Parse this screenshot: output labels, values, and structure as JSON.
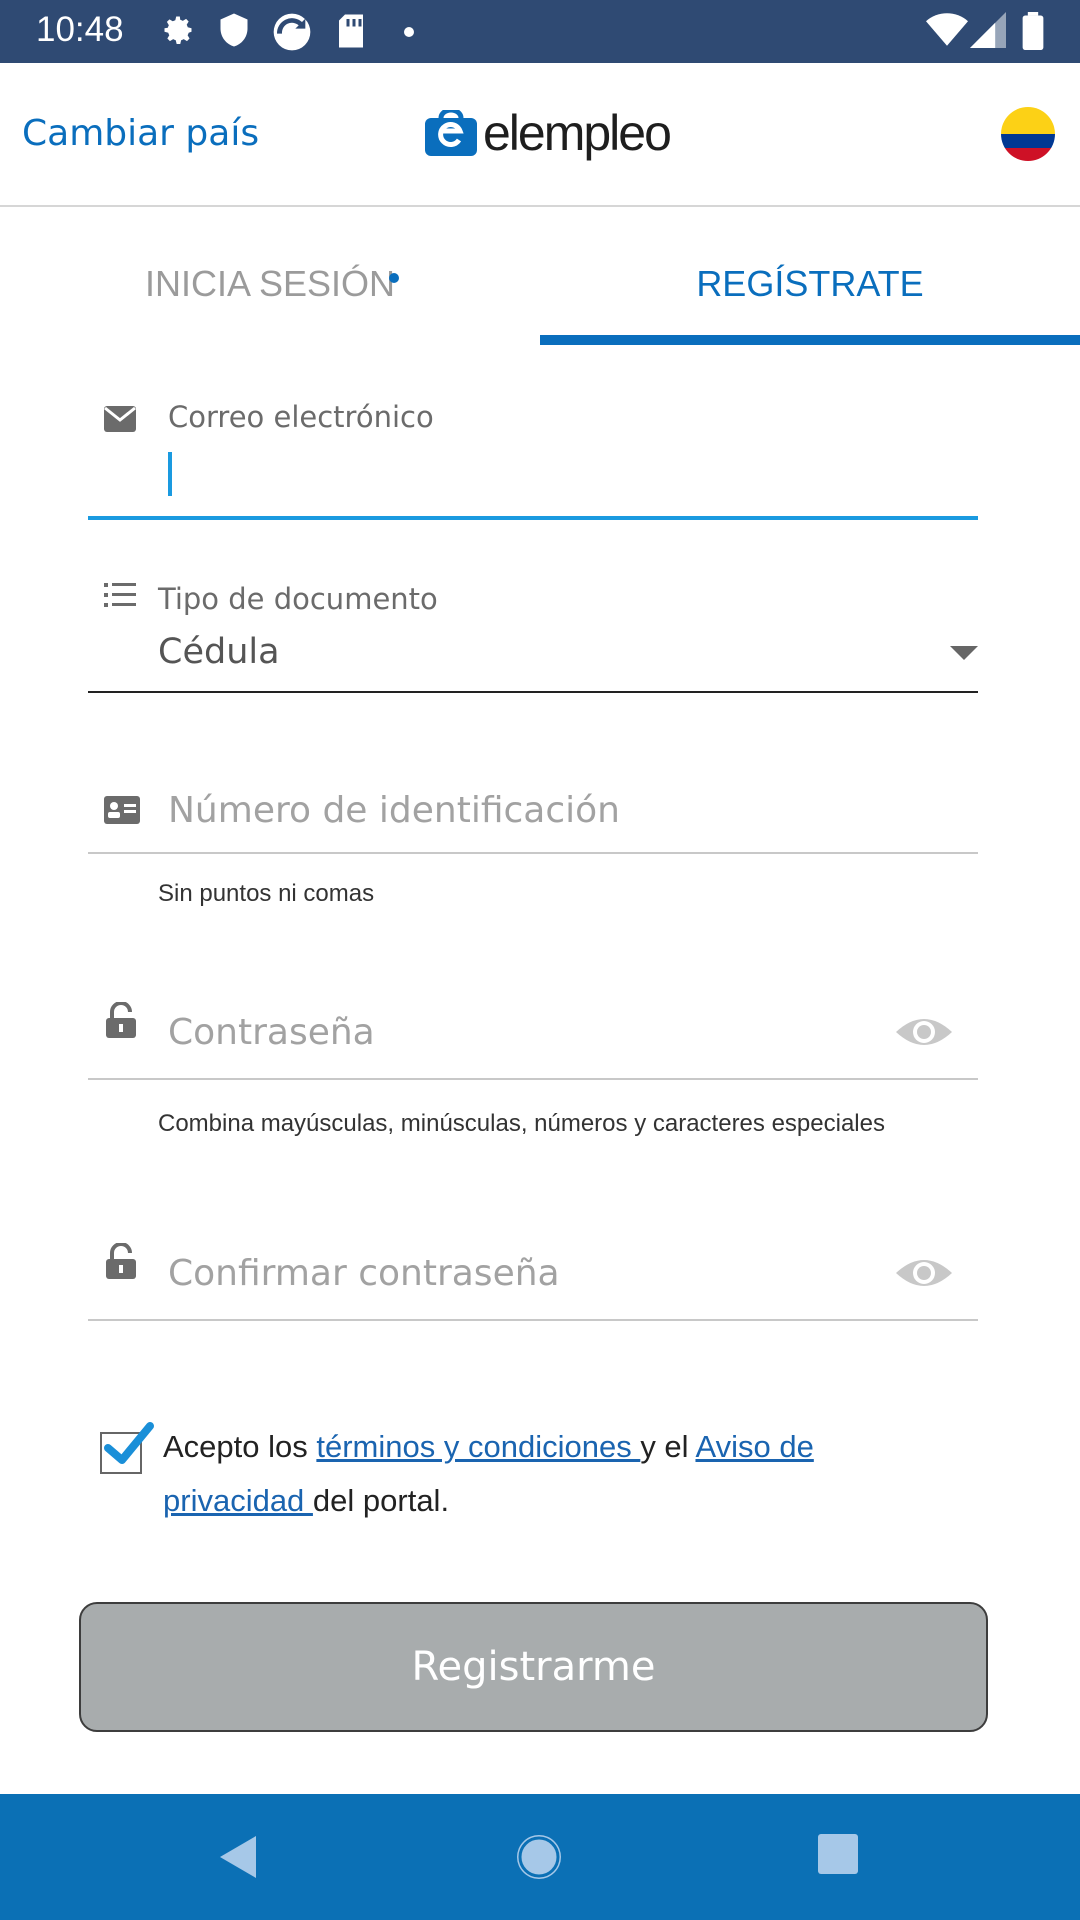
{
  "status_bar": {
    "time": "10:48"
  },
  "header": {
    "change_country": "Cambiar país",
    "logo_text": "elempleo",
    "flag_colors": [
      "#FCD116",
      "#003893",
      "#CE1126"
    ]
  },
  "tabs": [
    {
      "label": "INICIA SESIÓN",
      "active": false
    },
    {
      "label": "REGÍSTRATE",
      "active": true
    }
  ],
  "form": {
    "email": {
      "label": "Correo electrónico",
      "value": ""
    },
    "document_type": {
      "label": "Tipo de documento",
      "value": "Cédula"
    },
    "id_number": {
      "placeholder": "Número de identificación",
      "helper": "Sin puntos ni comas"
    },
    "password": {
      "placeholder": "Contraseña",
      "helper": "Combina mayúsculas, minúsculas, números y caracteres especiales"
    },
    "confirm_password": {
      "placeholder": "Confirmar contraseña"
    }
  },
  "terms": {
    "checked": true,
    "prefix": "Acepto los ",
    "link_terms": "términos y condiciones ",
    "middle": "y el ",
    "link_privacy": "Aviso de privacidad ",
    "suffix": "del portal."
  },
  "submit_label": "Registrarme",
  "colors": {
    "accent": "#0a6ebd",
    "status_bar": "#2f4a73",
    "nav_bar": "#0b70b5",
    "button_disabled": "#a8acad"
  }
}
